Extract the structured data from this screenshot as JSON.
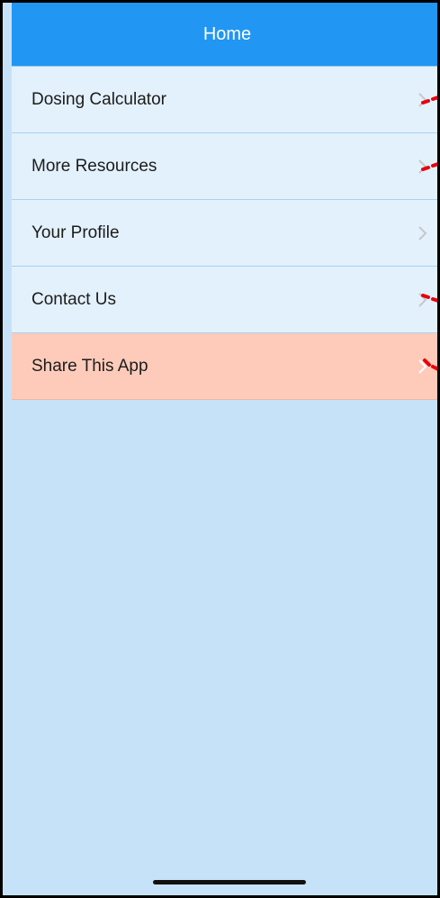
{
  "navbar": {
    "title": "Home",
    "color": "#2196f3"
  },
  "menu": {
    "items": [
      {
        "label": "Dosing Calculator",
        "icon": "chevron-right-icon",
        "annotated": true
      },
      {
        "label": "More Resources",
        "icon": "chevron-right-icon",
        "annotated": true
      },
      {
        "label": "Your Profile",
        "icon": "chevron-right-icon",
        "annotated": false
      },
      {
        "label": "Contact Us",
        "icon": "chevron-right-icon",
        "annotated": true
      },
      {
        "label": "Share This App",
        "icon": "chevron-right-icon",
        "annotated": true,
        "highlighted": true
      }
    ]
  },
  "colors": {
    "background": "#c6e2f8",
    "row": "#e3f1fd",
    "highlight_row": "#fecbba",
    "annotation": "#e8000d"
  }
}
